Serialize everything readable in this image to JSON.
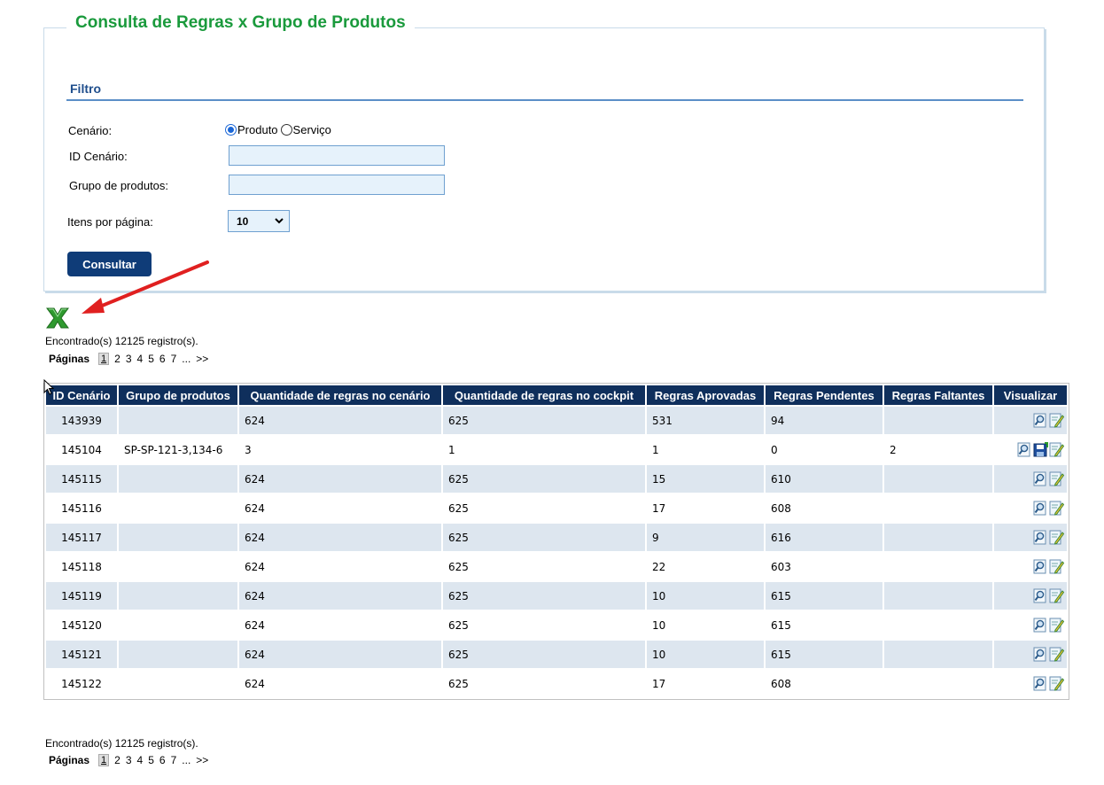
{
  "page": {
    "title": "Consulta de Regras x Grupo de Produtos"
  },
  "filter": {
    "title": "Filtro",
    "scenario_label": "Cenário:",
    "radio_product": "Produto",
    "radio_service": "Serviço",
    "id_label": "ID Cenário:",
    "id_value": "",
    "group_label": "Grupo de produtos:",
    "group_value": "",
    "per_page_label": "Itens por página:",
    "per_page_value": "10",
    "submit_label": "Consultar"
  },
  "results": {
    "found_text": "Encontrado(s) 12125 registro(s).",
    "pages_label": "Páginas",
    "pages": [
      "1",
      "2",
      "3",
      "4",
      "5",
      "6",
      "7",
      "...",
      ">>"
    ],
    "current_page": "1"
  },
  "table": {
    "columns": [
      "ID Cenário",
      "Grupo de produtos",
      "Quantidade de regras no cenário",
      "Quantidade de regras no cockpit",
      "Regras Aprovadas",
      "Regras Pendentes",
      "Regras Faltantes",
      "Visualizar"
    ],
    "rows": [
      {
        "id": "143939",
        "group": "",
        "q_cen": "624",
        "q_cock": "625",
        "aprov": "531",
        "pend": "94",
        "falt": "",
        "save": false
      },
      {
        "id": "145104",
        "group": "SP-SP-121-3,134-6",
        "q_cen": "3",
        "q_cock": "1",
        "aprov": "1",
        "pend": "0",
        "falt": "2",
        "save": true
      },
      {
        "id": "145115",
        "group": "",
        "q_cen": "624",
        "q_cock": "625",
        "aprov": "15",
        "pend": "610",
        "falt": "",
        "save": false
      },
      {
        "id": "145116",
        "group": "",
        "q_cen": "624",
        "q_cock": "625",
        "aprov": "17",
        "pend": "608",
        "falt": "",
        "save": false
      },
      {
        "id": "145117",
        "group": "",
        "q_cen": "624",
        "q_cock": "625",
        "aprov": "9",
        "pend": "616",
        "falt": "",
        "save": false
      },
      {
        "id": "145118",
        "group": "",
        "q_cen": "624",
        "q_cock": "625",
        "aprov": "22",
        "pend": "603",
        "falt": "",
        "save": false
      },
      {
        "id": "145119",
        "group": "",
        "q_cen": "624",
        "q_cock": "625",
        "aprov": "10",
        "pend": "615",
        "falt": "",
        "save": false
      },
      {
        "id": "145120",
        "group": "",
        "q_cen": "624",
        "q_cock": "625",
        "aprov": "10",
        "pend": "615",
        "falt": "",
        "save": false
      },
      {
        "id": "145121",
        "group": "",
        "q_cen": "624",
        "q_cock": "625",
        "aprov": "10",
        "pend": "615",
        "falt": "",
        "save": false
      },
      {
        "id": "145122",
        "group": "",
        "q_cen": "624",
        "q_cock": "625",
        "aprov": "17",
        "pend": "608",
        "falt": "",
        "save": false
      }
    ]
  },
  "icons": {
    "export": "excel-export-icon",
    "view": "magnifier-icon",
    "save": "save-icon",
    "edit": "edit-icon",
    "annotation": "red-arrow-icon"
  },
  "colors": {
    "title_green": "#1a9a3c",
    "header_navy": "#0f2f5c",
    "button_navy": "#0f3c78",
    "row_alt": "#dde6ef",
    "arrow_red": "#e02020"
  }
}
